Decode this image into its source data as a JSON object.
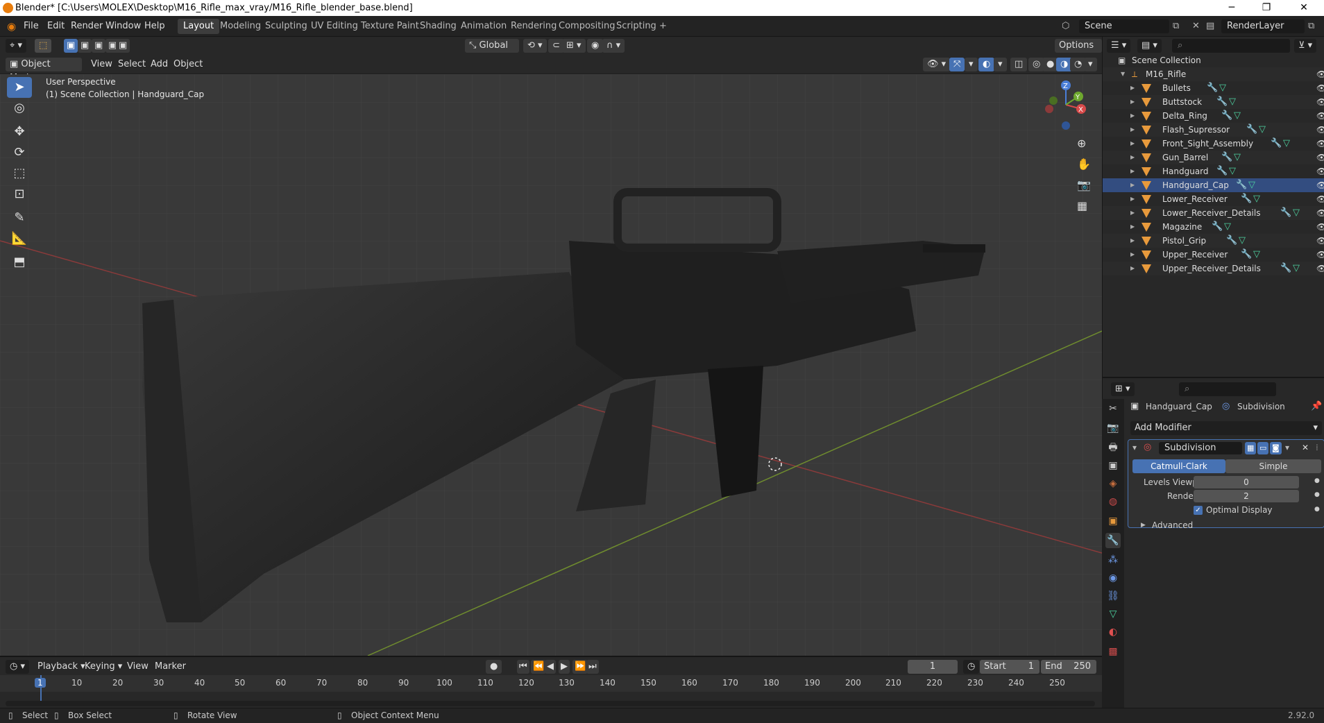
{
  "window": {
    "title": "Blender* [C:\\Users\\MOLEX\\Desktop\\M16_Rifle_max_vray/M16_Rifle_blender_base.blend]",
    "min_glyph": "─",
    "max_glyph": "❐",
    "close_glyph": "✕"
  },
  "menu": [
    "File",
    "Edit",
    "Render",
    "Window",
    "Help"
  ],
  "workspaces": [
    "Layout",
    "Modeling",
    "Sculpting",
    "UV Editing",
    "Texture Paint",
    "Shading",
    "Animation",
    "Rendering",
    "Compositing",
    "Scripting",
    "+"
  ],
  "scene": {
    "name": "Scene",
    "view_layer": "RenderLayer"
  },
  "viewport": {
    "mode": "Object Mode",
    "menus": [
      "View",
      "Select",
      "Add",
      "Object"
    ],
    "orientation": "Global",
    "options": "Options",
    "overlay_title": "User Perspective",
    "overlay_sub": "(1) Scene Collection | Handguard_Cap",
    "gizmo": {
      "z": "Z",
      "y": "Y",
      "x": "X"
    }
  },
  "outliner": {
    "root": "Scene Collection",
    "collection": "M16_Rifle",
    "objects": [
      "Bullets",
      "Buttstock",
      "Delta_Ring",
      "Flash_Supressor",
      "Front_Sight_Assembly",
      "Gun_Barrel",
      "Handguard",
      "Handguard_Cap",
      "Lower_Receiver",
      "Lower_Receiver_Details",
      "Magazine",
      "Pistol_Grip",
      "Upper_Receiver",
      "Upper_Receiver_Details"
    ],
    "selected": "Handguard_Cap"
  },
  "properties": {
    "object": "Handguard_Cap",
    "modifier_crumb": "Subdivision",
    "add_modifier": "Add Modifier",
    "modifier_name": "Subdivision",
    "tab_catmull": "Catmull-Clark",
    "tab_simple": "Simple",
    "levels_label": "Levels Viewport",
    "levels_value": "0",
    "render_label": "Render",
    "render_value": "2",
    "optimal_label": "Optimal Display",
    "advanced_label": "Advanced"
  },
  "timeline": {
    "menus": [
      "Playback",
      "Keying",
      "View",
      "Marker"
    ],
    "current_frame": "1",
    "start_label": "Start",
    "start": "1",
    "end_label": "End",
    "end": "250",
    "ticks": [
      "1",
      "10",
      "20",
      "30",
      "40",
      "50",
      "60",
      "70",
      "80",
      "90",
      "100",
      "110",
      "120",
      "130",
      "140",
      "150",
      "160",
      "170",
      "180",
      "190",
      "200",
      "210",
      "220",
      "230",
      "240",
      "250"
    ]
  },
  "status": {
    "select": "Select",
    "box_select": "Box Select",
    "rotate": "Rotate View",
    "context": "Object Context Menu",
    "version": "2.92.0"
  },
  "colors": {
    "accent": "#4772b3",
    "object_orange": "#e89a3c",
    "mesh_green": "#4dd2a0",
    "modifier_blue": "#6e9ae8"
  }
}
